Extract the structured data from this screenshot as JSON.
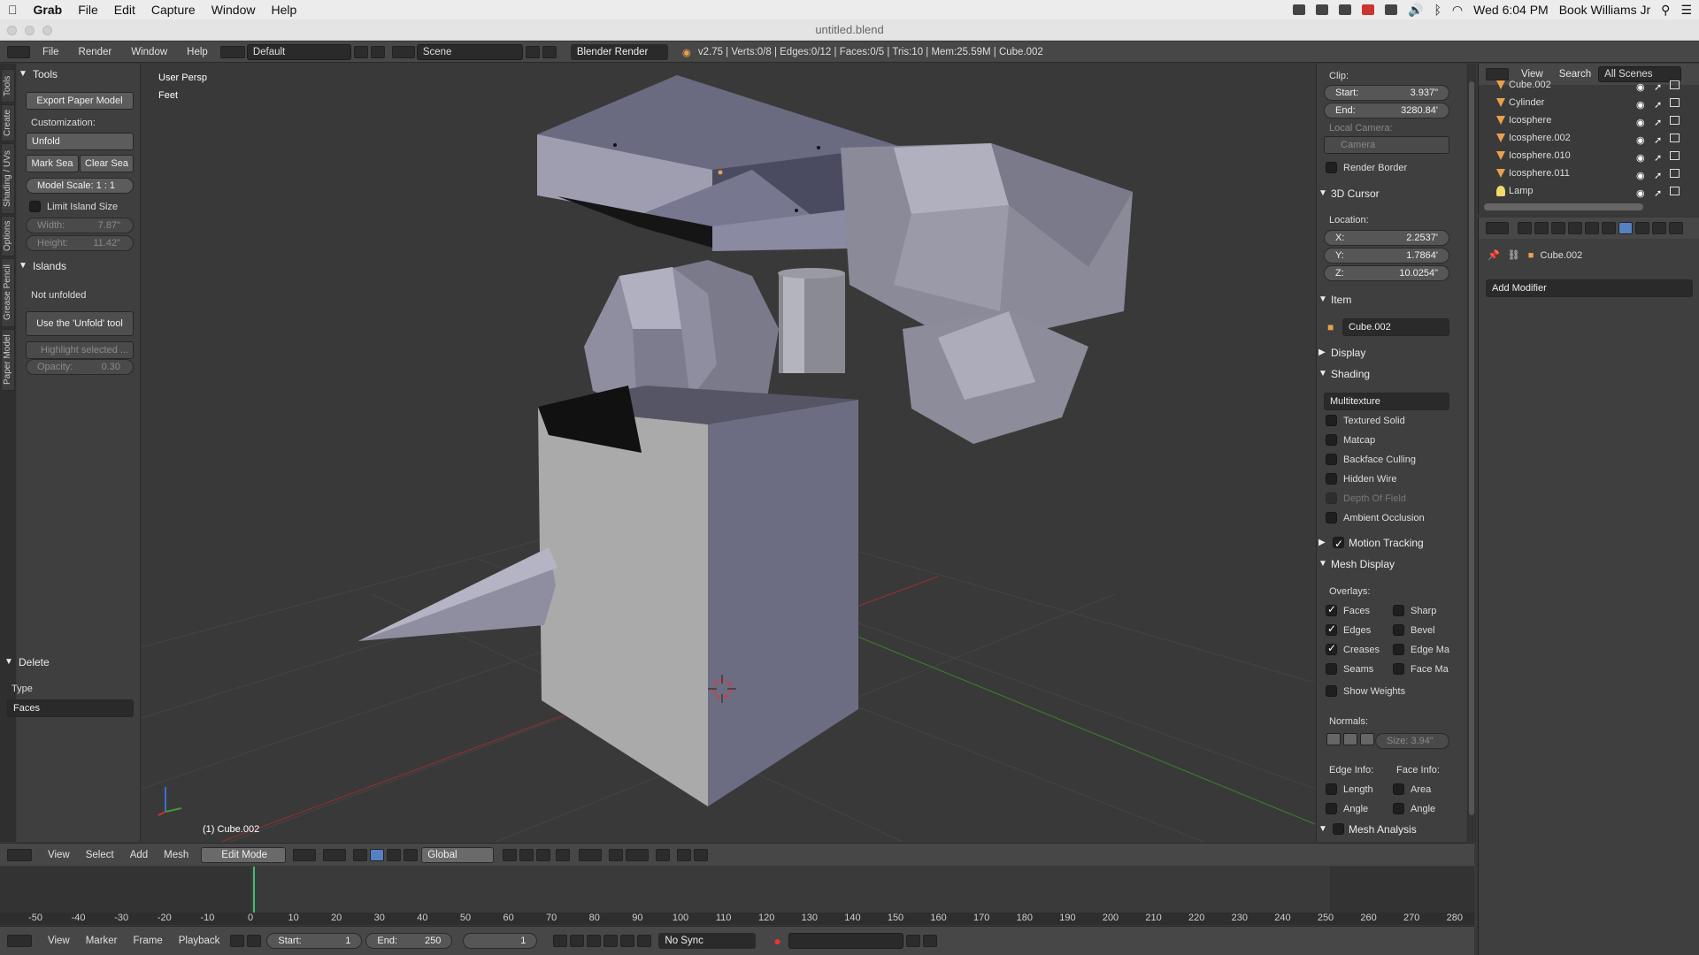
{
  "macos": {
    "menus": [
      "Grab",
      "File",
      "Edit",
      "Capture",
      "Window",
      "Help"
    ],
    "clock": "Wed 6:04 PM",
    "user": "Book Williams Jr"
  },
  "window": {
    "title": "untitled.blend"
  },
  "info_header": {
    "menus": [
      "File",
      "Render",
      "Window",
      "Help"
    ],
    "layout": "Default",
    "scene": "Scene",
    "engine": "Blender Render",
    "stats": "v2.75 | Verts:0/8 | Edges:0/12 | Faces:0/5 | Tris:10 | Mem:25.59M | Cube.002"
  },
  "vertical_tabs": [
    "Tools",
    "Create",
    "Shading / UVs",
    "Options",
    "Grease Pencil",
    "Paper Model"
  ],
  "tools": {
    "panel_title": "Tools",
    "export_button": "Export Paper Model",
    "customization_label": "Customization:",
    "unfold_button": "Unfold",
    "mark_seam_button": "Mark Sea",
    "clear_seam_button": "Clear Sea",
    "model_scale": "Model Scale:   1 : 1",
    "limit_island_label": "Limit Island Size",
    "width": {
      "label": "Width:",
      "value": "7.87\""
    },
    "height": {
      "label": "Height:",
      "value": "11.42\""
    },
    "islands_title": "Islands",
    "not_unfolded": "Not unfolded",
    "use_unfold_button": "Use the 'Unfold' tool",
    "highlight_selected": "Highlight selected ...",
    "opacity": {
      "label": "Opacity:",
      "value": "0.30"
    },
    "delete_title": "Delete",
    "type_label": "Type",
    "type_value": "Faces"
  },
  "viewport": {
    "persp_label": "User Persp",
    "units_label": "Feet",
    "object_label": "(1) Cube.002"
  },
  "npanel": {
    "clip_label": "Clip:",
    "clip_start": {
      "label": "Start:",
      "value": "3.937\""
    },
    "clip_end": {
      "label": "End:",
      "value": "3280.84'"
    },
    "local_camera_label": "Local Camera:",
    "camera_value": "Camera",
    "render_border": "Render Border",
    "cursor_title": "3D Cursor",
    "location_label": "Location:",
    "cursor_x": {
      "label": "X:",
      "value": "2.2537'"
    },
    "cursor_y": {
      "label": "Y:",
      "value": "1.7864'"
    },
    "cursor_z": {
      "label": "Z:",
      "value": "10.0254\""
    },
    "item_title": "Item",
    "item_name": "Cube.002",
    "display_title": "Display",
    "shading_title": "Shading",
    "shading_mode": "Multitexture",
    "shading_opts": [
      "Textured Solid",
      "Matcap",
      "Backface Culling",
      "Hidden Wire",
      "Depth Of Field",
      "Ambient Occlusion"
    ],
    "motion_tracking": "Motion Tracking",
    "mesh_display_title": "Mesh Display",
    "overlays_label": "Overlays:",
    "overlays_left": [
      "Faces",
      "Edges",
      "Creases",
      "Seams"
    ],
    "overlays_right": [
      "Sharp",
      "Bevel",
      "Edge Ma",
      "Face Ma"
    ],
    "show_weights": "Show Weights",
    "normals_label": "Normals:",
    "normals_size": "Size: 3.94\"",
    "edge_info_label": "Edge Info:",
    "face_info_label": "Face Info:",
    "edge_info": [
      "Length",
      "Angle"
    ],
    "face_info": [
      "Area",
      "Angle"
    ],
    "mesh_analysis": "Mesh Analysis"
  },
  "outliner": {
    "menus": [
      "View",
      "Search"
    ],
    "filter": "All Scenes",
    "rows": [
      "Cube.002",
      "Cylinder",
      "Icosphere",
      "Icosphere.002",
      "Icosphere.010",
      "Icosphere.011",
      "Lamp"
    ]
  },
  "properties": {
    "object_name": "Cube.002",
    "add_modifier": "Add Modifier"
  },
  "view3d_header": {
    "menus": [
      "View",
      "Select",
      "Add",
      "Mesh"
    ],
    "mode": "Edit Mode",
    "orientation": "Global"
  },
  "timeline": {
    "ticks": [
      "-50",
      "-40",
      "-30",
      "-20",
      "-10",
      "0",
      "10",
      "20",
      "30",
      "40",
      "50",
      "60",
      "70",
      "80",
      "90",
      "100",
      "110",
      "120",
      "130",
      "140",
      "150",
      "160",
      "170",
      "180",
      "190",
      "200",
      "210",
      "220",
      "230",
      "240",
      "250",
      "260",
      "270",
      "280"
    ],
    "menus": [
      "View",
      "Marker",
      "Frame",
      "Playback"
    ],
    "start": {
      "label": "Start:",
      "value": "1"
    },
    "end": {
      "label": "End:",
      "value": "250"
    },
    "current": "1",
    "sync": "No Sync"
  }
}
